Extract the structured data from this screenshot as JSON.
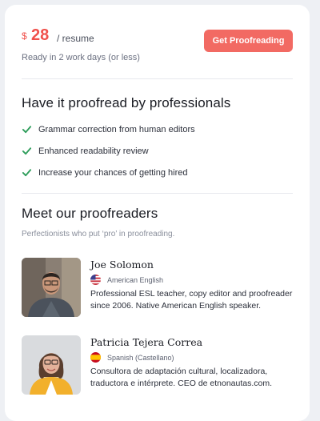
{
  "pricing": {
    "currency": "$",
    "amount": "28",
    "unit": "/ resume",
    "delivery": "Ready in 2 work days (or less)",
    "button_label": "Get Proofreading"
  },
  "features": {
    "title": "Have it proofread by professionals",
    "items": [
      {
        "label": "Grammar correction from human editors",
        "icon": "check-icon"
      },
      {
        "label": "Enhanced readability review",
        "icon": "check-icon"
      },
      {
        "label": "Increase your chances of getting hired",
        "icon": "check-icon"
      }
    ]
  },
  "proofreaders": {
    "title": "Meet our proofreaders",
    "subtitle": "Perfectionists who put ‘pro’ in proofreading.",
    "people": [
      {
        "name": "Joe Solomon",
        "language": "American English",
        "flag": "us-flag-icon",
        "bio": "Professional ESL teacher, copy editor and proofreader since 2006. Native American English speaker."
      },
      {
        "name": "Patricia Tejera Correa",
        "language": "Spanish (Castellano)",
        "flag": "spain-flag-icon",
        "bio": "Consultora de adaptación cultural, localizadora, traductora e intérprete. CEO de etnonautas.com."
      }
    ]
  },
  "colors": {
    "accent": "#f0504b",
    "button": "#f26a63",
    "check": "#2e9d5b",
    "divider": "#e6e8ee"
  }
}
